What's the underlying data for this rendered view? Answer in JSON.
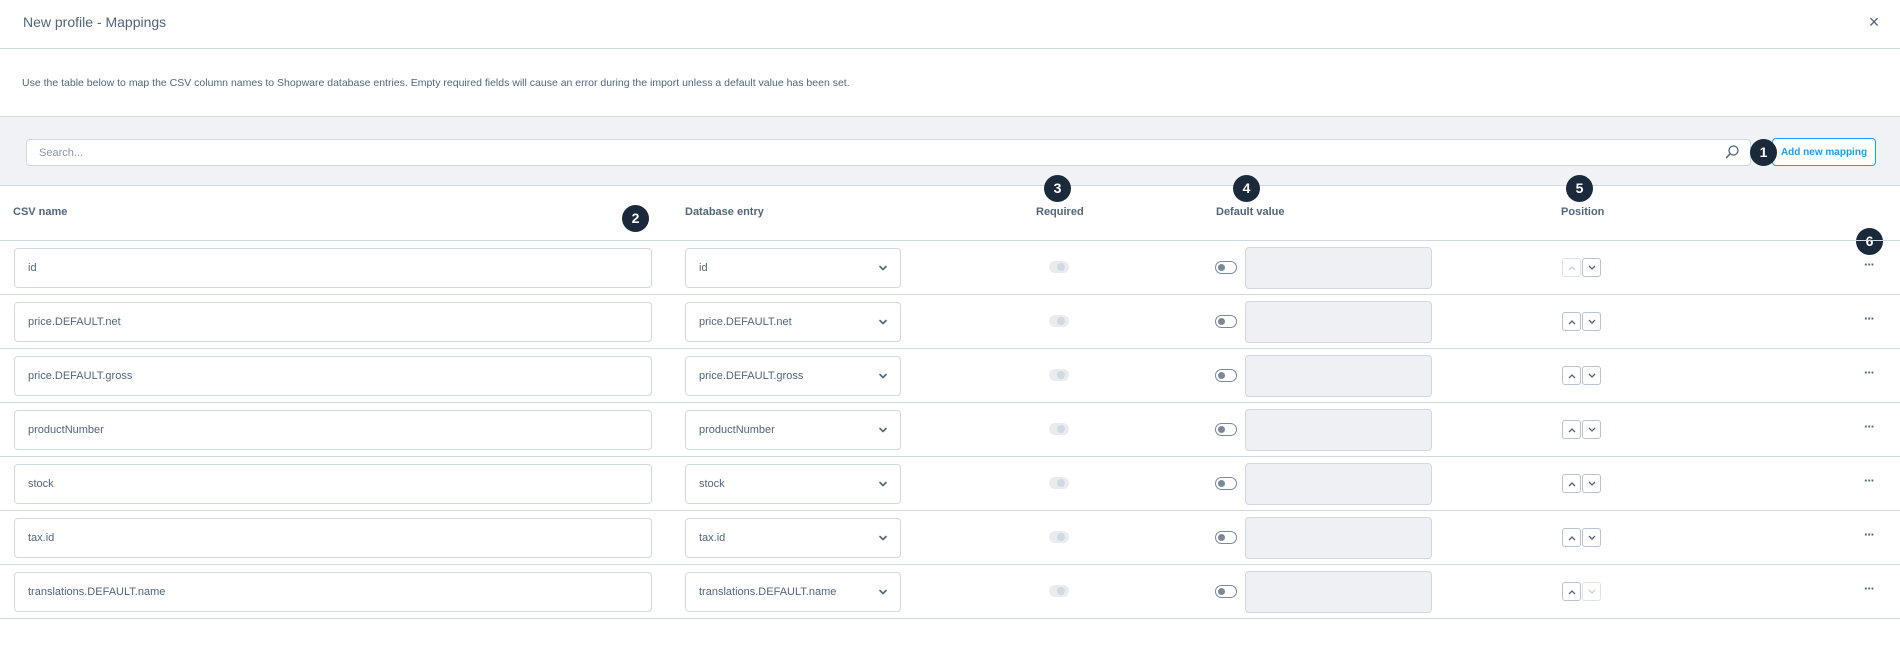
{
  "header": {
    "title": "New profile - Mappings",
    "close_label": "×"
  },
  "description": "Use the table below to map the CSV column names to Shopware database entries. Empty required fields will cause an error during the import unless a default value has been set.",
  "toolbar": {
    "search_placeholder": "Search...",
    "add_button_label": "Add new mapping"
  },
  "columns": {
    "csv_name": "CSV name",
    "database_entry": "Database entry",
    "required": "Required",
    "default_value": "Default value",
    "position": "Position"
  },
  "badges": [
    "1",
    "2",
    "3",
    "4",
    "5",
    "6"
  ],
  "rows": [
    {
      "csv_name": "id",
      "database_entry": "id",
      "up_enabled": false,
      "down_enabled": true
    },
    {
      "csv_name": "price.DEFAULT.net",
      "database_entry": "price.DEFAULT.net",
      "up_enabled": true,
      "down_enabled": true
    },
    {
      "csv_name": "price.DEFAULT.gross",
      "database_entry": "price.DEFAULT.gross",
      "up_enabled": true,
      "down_enabled": true
    },
    {
      "csv_name": "productNumber",
      "database_entry": "productNumber",
      "up_enabled": true,
      "down_enabled": true
    },
    {
      "csv_name": "stock",
      "database_entry": "stock",
      "up_enabled": true,
      "down_enabled": true
    },
    {
      "csv_name": "tax.id",
      "database_entry": "tax.id",
      "up_enabled": true,
      "down_enabled": true
    },
    {
      "csv_name": "translations.DEFAULT.name",
      "database_entry": "translations.DEFAULT.name",
      "up_enabled": true,
      "down_enabled": false
    }
  ],
  "more_label": "···",
  "colors": {
    "accent": "#189eff",
    "badge": "#1a2a3a",
    "border": "#d1d9e0",
    "text": "#52667a",
    "toolbar_bg": "#f0f2f5"
  }
}
